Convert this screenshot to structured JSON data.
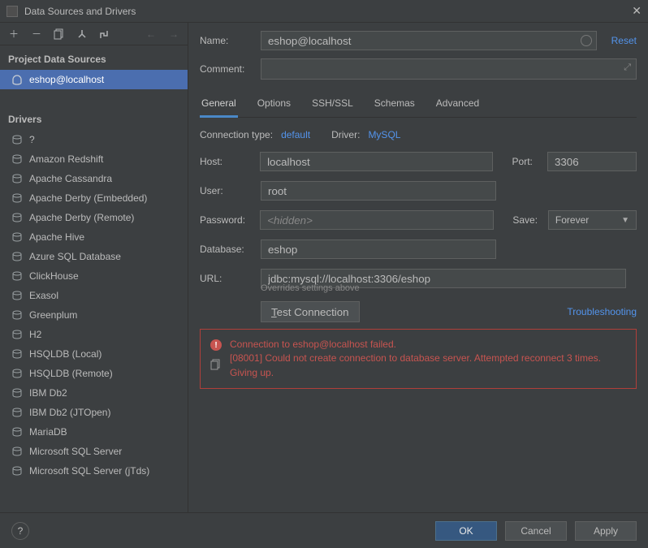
{
  "window": {
    "title": "Data Sources and Drivers"
  },
  "sidebar": {
    "project_header": "Project Data Sources",
    "selected_ds": "eshop@localhost",
    "drivers_header": "Drivers",
    "drivers": [
      "?",
      "Amazon Redshift",
      "Apache Cassandra",
      "Apache Derby (Embedded)",
      "Apache Derby (Remote)",
      "Apache Hive",
      "Azure SQL Database",
      "ClickHouse",
      "Exasol",
      "Greenplum",
      "H2",
      "HSQLDB (Local)",
      "HSQLDB (Remote)",
      "IBM Db2",
      "IBM Db2 (JTOpen)",
      "MariaDB",
      "Microsoft SQL Server",
      "Microsoft SQL Server (jTds)"
    ]
  },
  "form": {
    "name_label": "Name:",
    "name_value": "eshop@localhost",
    "reset": "Reset",
    "comment_label": "Comment:",
    "tabs": [
      "General",
      "Options",
      "SSH/SSL",
      "Schemas",
      "Advanced"
    ],
    "conn_type_label": "Connection type:",
    "conn_type_value": "default",
    "driver_label": "Driver:",
    "driver_value": "MySQL",
    "host_label": "Host:",
    "host_value": "localhost",
    "port_label": "Port:",
    "port_value": "3306",
    "user_label": "User:",
    "user_value": "root",
    "password_label": "Password:",
    "password_placeholder": "<hidden>",
    "save_label": "Save:",
    "save_value": "Forever",
    "db_label": "Database:",
    "db_value": "eshop",
    "url_label": "URL:",
    "url_value": "jdbc:mysql://localhost:3306/eshop",
    "url_hint": "Overrides settings above",
    "test_btn_pre": "T",
    "test_btn_rest": "est Connection",
    "troubleshooting": "Troubleshooting",
    "error_line1": "Connection to eshop@localhost failed.",
    "error_line2": "[08001] Could not create connection to database server. Attempted reconnect 3 times. Giving up."
  },
  "buttons": {
    "ok": "OK",
    "cancel": "Cancel",
    "apply": "Apply"
  }
}
